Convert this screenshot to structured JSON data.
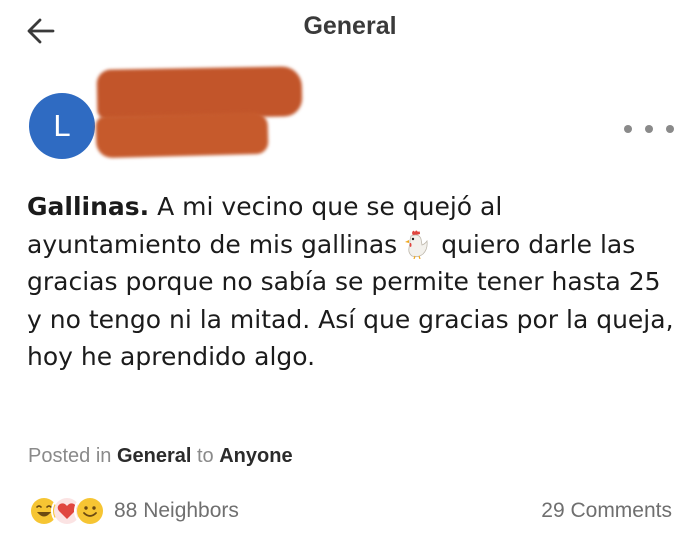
{
  "header": {
    "title": "General",
    "back_icon": "arrow-left-icon"
  },
  "author": {
    "avatar_letter": "L",
    "avatar_color": "#2f6bc2",
    "name_redacted": true,
    "redaction_color": "#c2552a"
  },
  "post": {
    "title": "Gallinas.",
    "text_before_emoji": " A mi vecino que se quejó al ayuntamiento de mis gallinas",
    "emoji": "chicken-icon",
    "text_after_emoji": "quiero darle las gracias porque no sabía se permite tener hasta 25 y no tengo ni la mitad. Así que gracias por la queja, hoy he aprendido algo."
  },
  "meta": {
    "posted_prefix": "Posted in ",
    "category": "General",
    "audience_prefix": " to ",
    "audience": "Anyone"
  },
  "footer": {
    "reaction_icons": [
      "laugh-emoji-icon",
      "heart-icon",
      "smile-emoji-icon"
    ],
    "neighbors_label": "88 Neighbors",
    "comments_label": "29 Comments"
  },
  "colors": {
    "accent": "#2f6bc2",
    "muted_text": "#8a8a8a",
    "heart": "#e0463f",
    "emoji_yellow": "#f6c533"
  }
}
